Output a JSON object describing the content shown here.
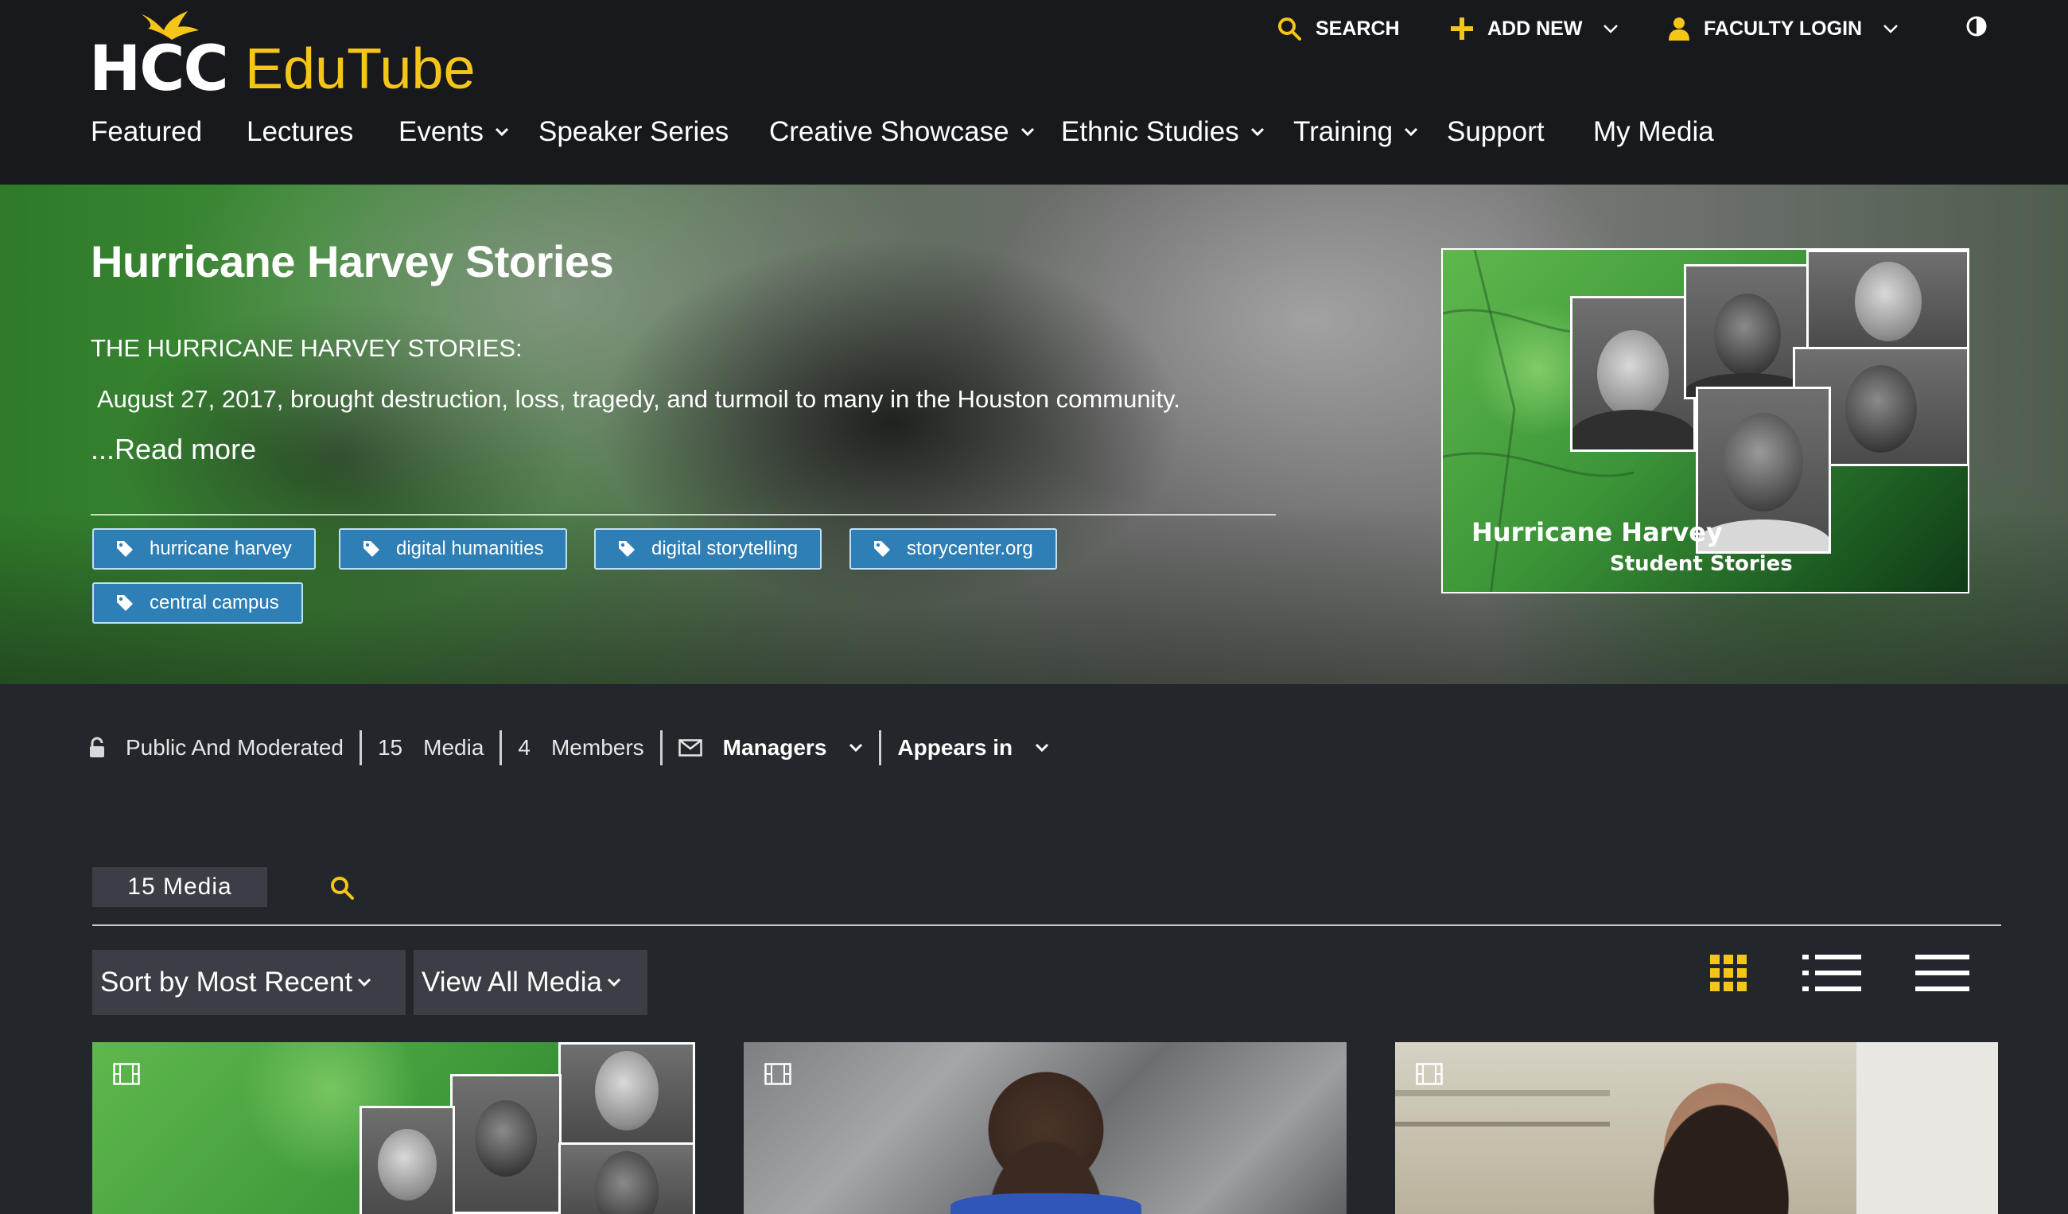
{
  "header": {
    "logo": {
      "hcc": "HCC",
      "brand": "EduTube"
    },
    "utility": {
      "search_label": "SEARCH",
      "add_new_label": "ADD NEW",
      "faculty_login_label": "FACULTY LOGIN"
    },
    "nav": [
      {
        "label": "Featured"
      },
      {
        "label": "Lectures"
      },
      {
        "label": "Events"
      },
      {
        "label": "Speaker Series"
      },
      {
        "label": "Creative Showcase"
      },
      {
        "label": "Ethnic Studies"
      },
      {
        "label": "Training"
      },
      {
        "label": "Support"
      },
      {
        "label": "My Media"
      }
    ]
  },
  "hero": {
    "title": "Hurricane Harvey Stories",
    "subtitle": "THE HURRICANE HARVEY STORIES:",
    "description": "August 27, 2017, brought destruction, loss, tragedy, and turmoil to many in the Houston community.",
    "read_more": "...Read more",
    "tags": [
      {
        "label": "hurricane harvey"
      },
      {
        "label": "digital humanities"
      },
      {
        "label": "digital storytelling"
      },
      {
        "label": "storycenter.org"
      },
      {
        "label": "central campus"
      }
    ],
    "thumbnail": {
      "caption_line1": "Hurricane Harvey",
      "caption_line2": "Student Stories"
    }
  },
  "meta": {
    "visibility": "Public And Moderated",
    "media_count": "15",
    "media_label": "Media",
    "members_count": "4",
    "members_label": "Members",
    "managers_label": "Managers",
    "appears_in_label": "Appears in"
  },
  "media": {
    "tab_label": "15 Media",
    "sort_label": "Sort by Most Recent",
    "filter_label": "View All Media"
  },
  "colors": {
    "accent": "#f5c518",
    "tag_bg": "#2e7fb6",
    "header_bg": "#17191c",
    "page_bg": "#23262b"
  }
}
